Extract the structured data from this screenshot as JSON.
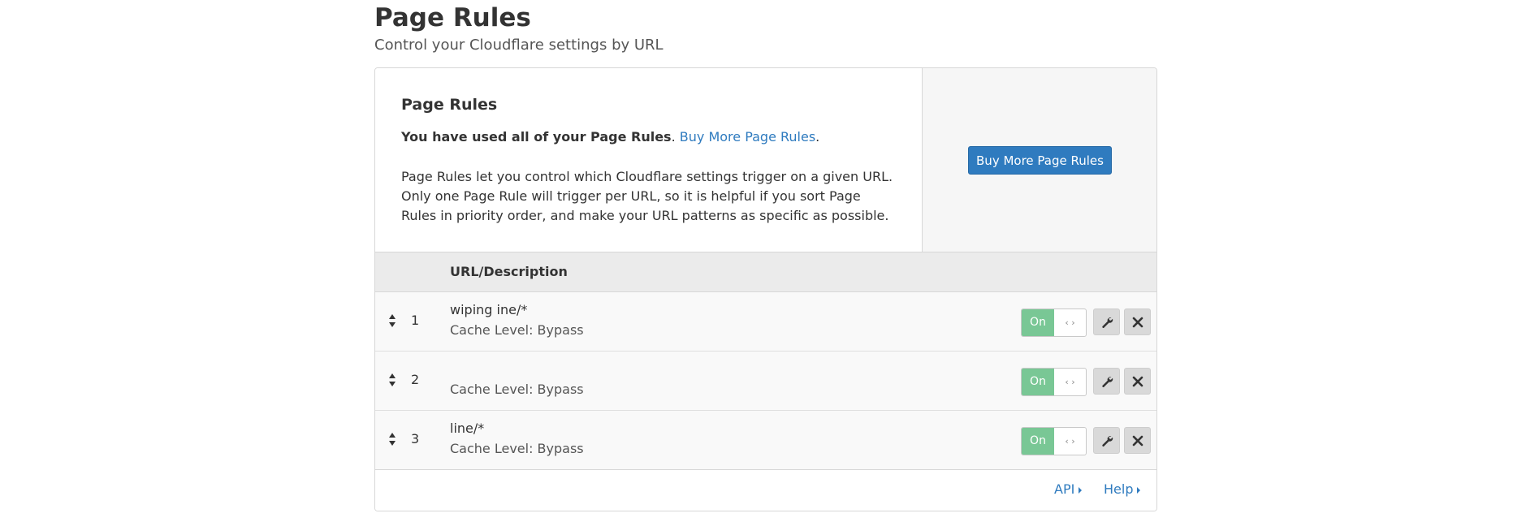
{
  "header": {
    "title": "Page Rules",
    "subtitle": "Control your Cloudflare settings by URL"
  },
  "info": {
    "title": "Page Rules",
    "usage_text": "You have used all of your Page Rules",
    "usage_period": ".",
    "usage_link": "Buy More Page Rules",
    "usage_end": ".",
    "description": "Page Rules let you control which Cloudflare settings trigger on a given URL. Only one Page Rule will trigger per URL, so it is helpful if you sort Page Rules in priority order, and make your URL patterns as specific as possible."
  },
  "aside": {
    "buy_button_label": "Buy More Page Rules"
  },
  "table": {
    "column_header": "URL/Description",
    "rows": [
      {
        "number": "1",
        "url": "wiping  ine/*",
        "setting": "Cache Level: Bypass",
        "toggle_label": "On",
        "toggle_grip": "‹ ›",
        "watermark": "wiping"
      },
      {
        "number": "2",
        "url": "",
        "setting": "Cache Level: Bypass",
        "toggle_label": "On",
        "toggle_grip": "‹ ›",
        "watermark": ""
      },
      {
        "number": "3",
        "url": "line/*",
        "setting": "Cache Level: Bypass",
        "toggle_label": "On",
        "toggle_grip": "‹ ›",
        "watermark": ""
      }
    ]
  },
  "footer": {
    "api_link": "API",
    "help_link": "Help"
  },
  "colors": {
    "accent": "#2f7bbf",
    "toggle_on": "#79c795",
    "header_bg": "#ebebeb",
    "aside_bg": "#f6f6f6"
  },
  "icons": {
    "drag": "sort-arrows-icon",
    "edit": "wrench-icon",
    "delete": "close-icon",
    "caret": "caret-right-icon"
  }
}
